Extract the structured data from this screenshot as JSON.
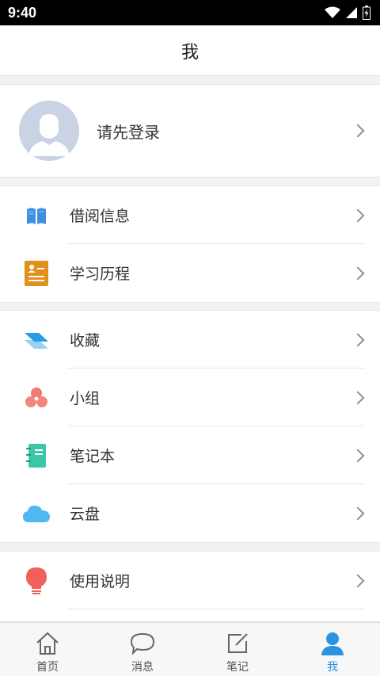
{
  "status_bar": {
    "time": "9:40"
  },
  "header": {
    "title": "我"
  },
  "profile": {
    "login_prompt": "请先登录"
  },
  "groups": [
    {
      "items": [
        {
          "label": "借阅信息",
          "icon": "book-icon"
        },
        {
          "label": "学习历程",
          "icon": "resume-icon"
        }
      ]
    },
    {
      "items": [
        {
          "label": "收藏",
          "icon": "layers-icon"
        },
        {
          "label": "小组",
          "icon": "group-icon"
        },
        {
          "label": "笔记本",
          "icon": "notebook-icon"
        },
        {
          "label": "云盘",
          "icon": "cloud-icon"
        }
      ]
    },
    {
      "items": [
        {
          "label": "使用说明",
          "icon": "lightbulb-icon"
        }
      ]
    }
  ],
  "tabs": [
    {
      "label": "首页",
      "icon": "home-icon"
    },
    {
      "label": "消息",
      "icon": "message-icon"
    },
    {
      "label": "笔记",
      "icon": "note-edit-icon"
    },
    {
      "label": "我",
      "icon": "person-icon",
      "active": true
    }
  ],
  "colors": {
    "accent": "#2a92e0",
    "book": "#3d8fe0",
    "resume": "#e0901c",
    "layers": "#2a9be8",
    "group": "#f07a6f",
    "notebook": "#3cc6a8",
    "cloud": "#4fb7f2",
    "lightbulb": "#f2605c"
  }
}
